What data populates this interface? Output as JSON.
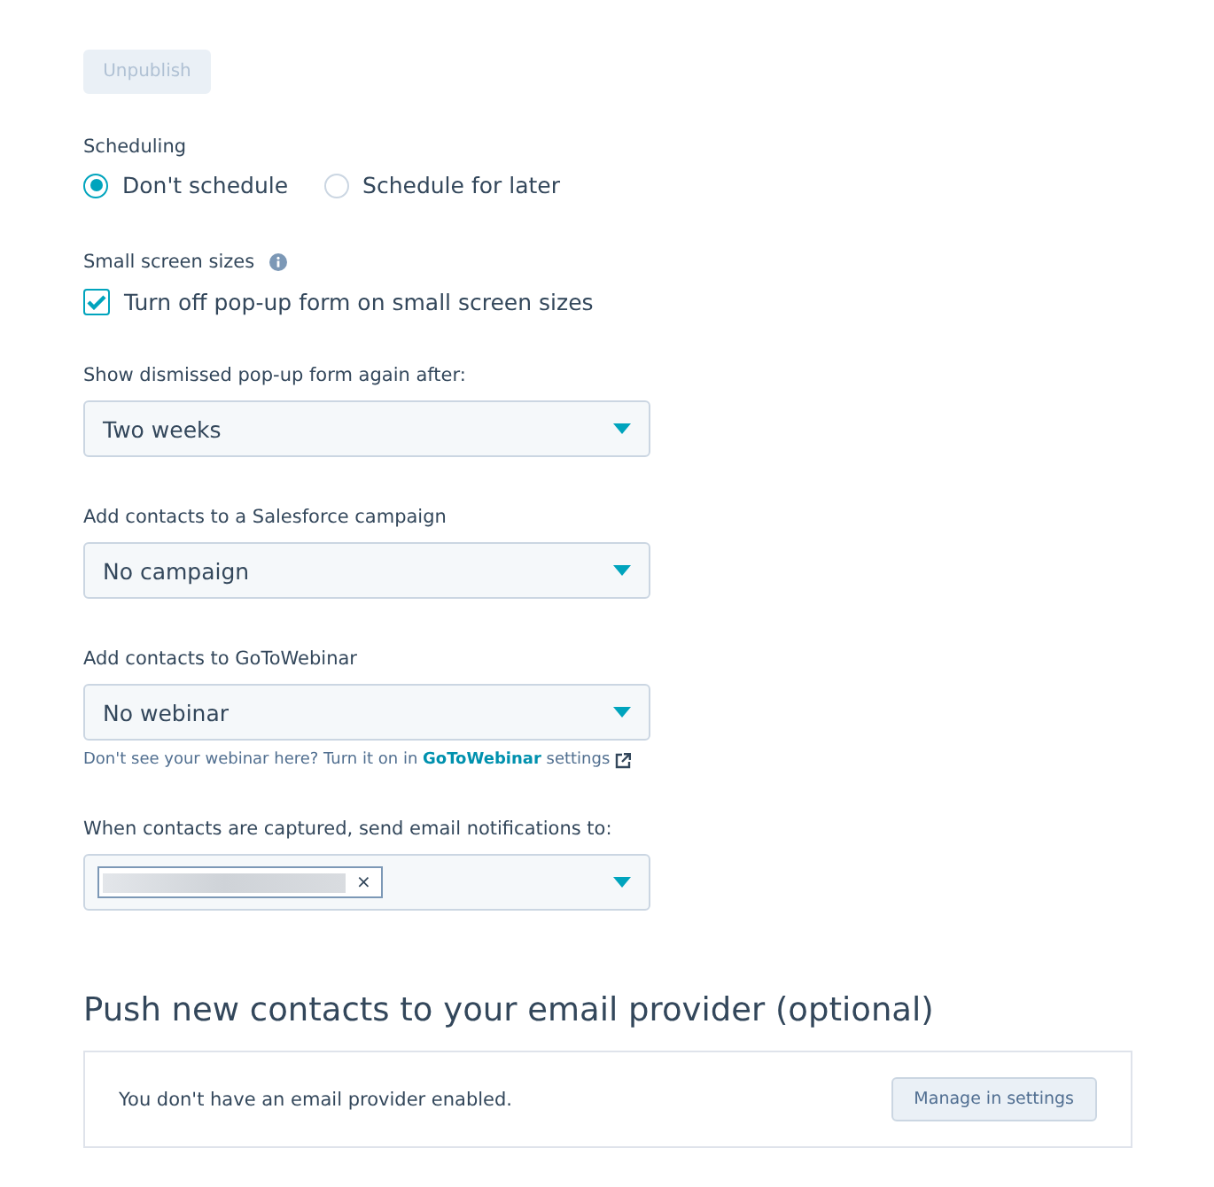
{
  "unpublish_button": {
    "label": "Unpublish",
    "disabled": true
  },
  "scheduling": {
    "label": "Scheduling",
    "options": [
      {
        "label": "Don't schedule",
        "selected": true
      },
      {
        "label": "Schedule for later",
        "selected": false
      }
    ]
  },
  "small_screen": {
    "label": "Small screen sizes",
    "checkbox": {
      "label": "Turn off pop-up form on small screen sizes",
      "checked": true
    }
  },
  "selects": [
    {
      "label": "Show dismissed pop-up form again after:",
      "value": "Two weeks"
    },
    {
      "label": "Add contacts to a Salesforce campaign",
      "value": "No campaign"
    },
    {
      "label": "Add contacts to GoToWebinar",
      "value": "No webinar",
      "hint": {
        "before": "Don't see your webinar here? Turn it on in",
        "link": "GoToWebinar",
        "after": "settings"
      }
    }
  ],
  "notifications": {
    "label": "When contacts are captured, send email notifications to:",
    "chip_remove": "×"
  },
  "email_provider": {
    "heading": "Push new contacts to your email provider (optional)",
    "message": "You don't have an email provider enabled.",
    "button": "Manage in settings"
  }
}
